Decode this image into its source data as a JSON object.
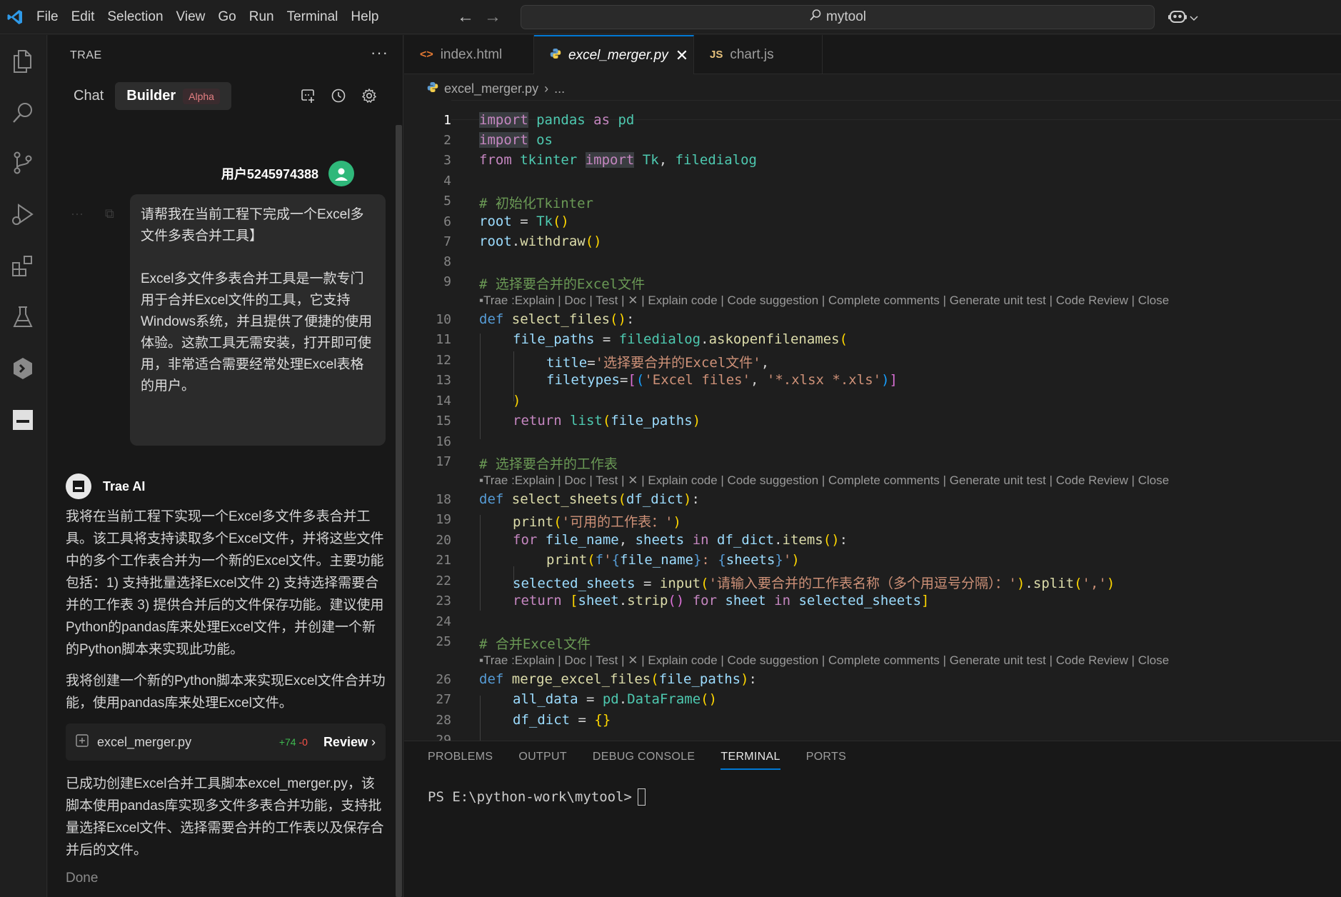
{
  "titlebar": {
    "menu": [
      "File",
      "Edit",
      "Selection",
      "View",
      "Go",
      "Run",
      "Terminal",
      "Help"
    ],
    "search_text": "mytool"
  },
  "sidepanel": {
    "title": "TRAE",
    "more": "···",
    "tab_chat": "Chat",
    "tab_builder": "Builder",
    "badge": "Alpha",
    "user_name": "用户5245974388",
    "user_message": [
      "请帮我在当前工程下完成一个Excel多文件多表合并工具】",
      "Excel多文件多表合并工具是一款专门用于合并Excel文件的工具，它支持Windows系统，并且提供了便捷的使用体验。这款工具无需安装，打开即可使用，非常适合需要经常处理Excel表格的用户。"
    ],
    "ai_name": "Trae AI",
    "ai_messages": [
      "我将在当前工程下实现一个Excel多文件多表合并工具。该工具将支持读取多个Excel文件，并将这些文件中的多个工作表合并为一个新的Excel文件。主要功能包括：1) 支持批量选择Excel文件 2) 支持选择需要合并的工作表 3) 提供合并后的文件保存功能。建议使用Python的pandas库来处理Excel文件，并创建一个新的Python脚本来实现此功能。",
      "我将创建一个新的Python脚本来实现Excel文件合并功能，使用pandas库来处理Excel文件。",
      "已成功创建Excel合并工具脚本excel_merger.py，该脚本使用pandas库实现多文件多表合并功能，支持批量选择Excel文件、选择需要合并的工作表以及保存合并后的文件。"
    ],
    "file_card": {
      "name": "excel_merger.py",
      "added": "+74",
      "removed": "-0",
      "review": "Review"
    },
    "status": "Done"
  },
  "editor": {
    "tabs": [
      {
        "label": "index.html",
        "icon": "html-icon"
      },
      {
        "label": "excel_merger.py",
        "icon": "python-icon",
        "active": true
      },
      {
        "label": "chart.js",
        "icon": "js-icon",
        "prefix": "JS"
      }
    ],
    "breadcrumb_file": "excel_merger.py",
    "breadcrumb_rest": "...",
    "line_numbers": [
      "1",
      "2",
      "3",
      "4",
      "5",
      "6",
      "7",
      "8",
      "9",
      "10",
      "11",
      "12",
      "13",
      "14",
      "15",
      "16",
      "17",
      "18",
      "19",
      "20",
      "21",
      "22",
      "23",
      "24",
      "25",
      "26",
      "27",
      "28",
      "29"
    ],
    "codelens": "Trae :Explain | Doc | Test | ✕ | Explain code | Code suggestion | Complete comments | Generate unit test | Code Review | Close",
    "code": {
      "l1_import": "import",
      "l1_rest": " pandas ",
      "l1_as": "as",
      "l1_pd": " pd",
      "l2_import": "import",
      "l2_os": " os",
      "l3_from": "from",
      "l3_mod": " tkinter ",
      "l3_import": "import",
      "l3_tk": " Tk",
      "l3_comma": ", ",
      "l3_fd": "filedialog",
      "l5": "# 初始化Tkinter",
      "l6_root": "root",
      "l6_eq": " = ",
      "l6_tk": "Tk",
      "l6_paren": "()",
      "l7_root": "root",
      "l7_dot": ".",
      "l7_fn": "withdraw",
      "l7_paren": "()",
      "l9": "# 选择要合并的Excel文件",
      "l10_def": "def",
      "l10_fn": " select_files",
      "l10_paren": "()",
      "l10_colon": ":",
      "l11_var": "file_paths",
      "l11_eq": " = ",
      "l11_mod": "filedialog",
      "l11_dot": ".",
      "l11_fn": "askopenfilenames",
      "l11_paren": "(",
      "l12_arg": "title",
      "l12_eq": "=",
      "l12_str": "'选择要合并的Excel文件'",
      "l12_comma": ",",
      "l13_arg": "filetypes",
      "l13_eq": "=",
      "l13_b": "[",
      "l13_p": "(",
      "l13_s1": "'Excel files'",
      "l13_comma": ", ",
      "l13_s2": "'*.xlsx *.xls'",
      "l13_pc": ")",
      "l13_bc": "]",
      "l14": ")",
      "l15_ret": "return",
      "l15_fn": " list",
      "l15_p": "(",
      "l15_var": "file_paths",
      "l15_pc": ")",
      "l17": "# 选择要合并的工作表",
      "l18_def": "def",
      "l18_fn": " select_sheets",
      "l18_p": "(",
      "l18_arg": "df_dict",
      "l18_pc": ")",
      "l18_colon": ":",
      "l19_fn": "print",
      "l19_p": "(",
      "l19_str": "'可用的工作表：'",
      "l19_pc": ")",
      "l20_for": "for",
      "l20_v1": " file_name",
      "l20_c": ", ",
      "l20_v2": "sheets",
      "l20_in": " in",
      "l20_obj": " df_dict",
      "l20_dot": ".",
      "l20_fn": "items",
      "l20_p": "()",
      "l20_colon": ":",
      "l21_fn": "print",
      "l21_p": "(",
      "l21_f": "f",
      "l21_q1": "'",
      "l21_b1": "{",
      "l21_v1": "file_name",
      "l21_b1c": "}",
      "l21_mid": ": ",
      "l21_b2": "{",
      "l21_v2": "sheets",
      "l21_b2c": "}",
      "l21_q2": "'",
      "l21_pc": ")",
      "l22_var": "selected_sheets",
      "l22_eq": " = ",
      "l22_fn": "input",
      "l22_p": "(",
      "l22_str": "'请输入要合并的工作表名称（多个用逗号分隔）：'",
      "l22_pc": ")",
      "l22_dot": ".",
      "l22_fn2": "split",
      "l22_p2": "(",
      "l22_str2": "','",
      "l22_pc2": ")",
      "l23_ret": "return",
      "l23_b": " [",
      "l23_v": "sheet",
      "l23_dot": ".",
      "l23_fn": "strip",
      "l23_p": "()",
      "l23_for": " for",
      "l23_v2": " sheet",
      "l23_in": " in",
      "l23_v3": " selected_sheets",
      "l23_bc": "]",
      "l25": "# 合并Excel文件",
      "l26_def": "def",
      "l26_fn": " merge_excel_files",
      "l26_p": "(",
      "l26_arg": "file_paths",
      "l26_pc": ")",
      "l26_colon": ":",
      "l27_var": "all_data",
      "l27_eq": " = ",
      "l27_mod": "pd",
      "l27_dot": ".",
      "l27_cls": "DataFrame",
      "l27_p": "()",
      "l28_var": "df_dict",
      "l28_eq": " = ",
      "l28_b": "{}"
    }
  },
  "panel": {
    "tabs": [
      "PROBLEMS",
      "OUTPUT",
      "DEBUG CONSOLE",
      "TERMINAL",
      "PORTS"
    ],
    "active_tab": "TERMINAL",
    "prompt": "PS E:\\python-work\\mytool>"
  }
}
